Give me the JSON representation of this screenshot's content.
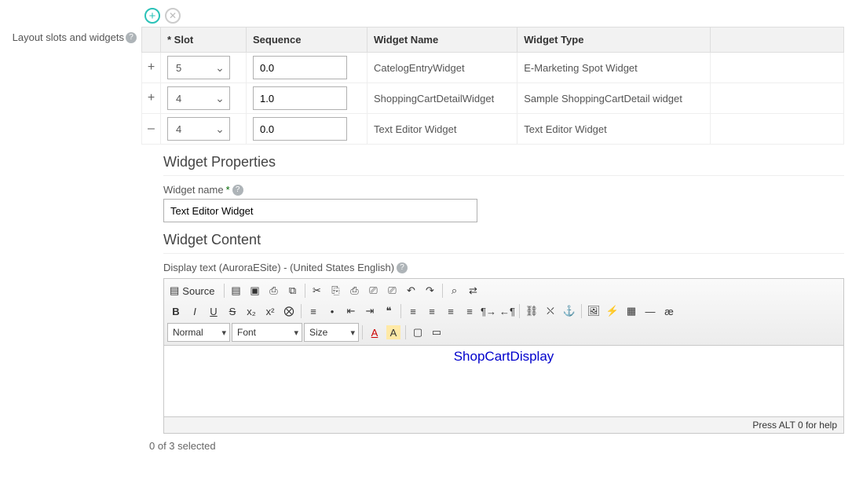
{
  "sidebar": {
    "label": "Layout slots and widgets"
  },
  "toolbar": {
    "add_label": "+",
    "close_label": "✕"
  },
  "table": {
    "headers": {
      "slot": "* Slot",
      "sequence": "Sequence",
      "widget_name": "Widget Name",
      "widget_type": "Widget Type"
    },
    "rows": [
      {
        "action": "+",
        "slot": "5",
        "sequence": "0.0",
        "name": "CatelogEntryWidget",
        "type": "E-Marketing Spot Widget"
      },
      {
        "action": "+",
        "slot": "4",
        "sequence": "1.0",
        "name": "ShoppingCartDetailWidget",
        "type": "Sample ShoppingCartDetail widget"
      },
      {
        "action": "–",
        "slot": "4",
        "sequence": "0.0",
        "name": "Text Editor Widget",
        "type": "Text Editor Widget"
      }
    ]
  },
  "properties": {
    "section_title": "Widget Properties",
    "name_label": "Widget name",
    "name_value": "Text Editor Widget",
    "required_mark": "*"
  },
  "content": {
    "section_title": "Widget Content",
    "display_label": "Display text (AuroraESite) - (United States English)",
    "editor": {
      "source_label": "Source",
      "format_label": "Normal",
      "font_label": "Font",
      "size_label": "Size",
      "body_link": "ShopCartDisplay",
      "status_text": "Press ALT 0 for help"
    }
  },
  "footer": {
    "selection_text": "0 of 3 selected"
  },
  "glyph": {
    "chevron_down": "⌄",
    "newdoc": "▤",
    "save": "▣",
    "print": "⎙",
    "preview": "⧉",
    "cut": "✂",
    "copy": "⎘",
    "paste": "⎙",
    "paste_text": "⎚",
    "paste_word": "⎚",
    "undo": "↶",
    "redo": "↷",
    "find": "⌕",
    "replace": "⇄",
    "bold": "B",
    "italic": "I",
    "underline": "U",
    "strike": "S",
    "sub": "x₂",
    "super": "x²",
    "removefmt": "⨂",
    "ol": "≡",
    "ul": "•",
    "outdent": "⇤",
    "indent": "⇥",
    "block": "❝",
    "left": "≡",
    "center": "≡",
    "right": "≡",
    "justify": "≡",
    "ltr": "¶→",
    "rtl": "←¶",
    "link": "⛓",
    "unlink": "⛌",
    "anchor": "⚓",
    "image": "🖼",
    "flash": "⚡",
    "table_i": "▦",
    "hr": "—",
    "special": "æ",
    "txtcolor": "A",
    "bgcolor": "A",
    "max": "▢",
    "blocks": "▭"
  }
}
